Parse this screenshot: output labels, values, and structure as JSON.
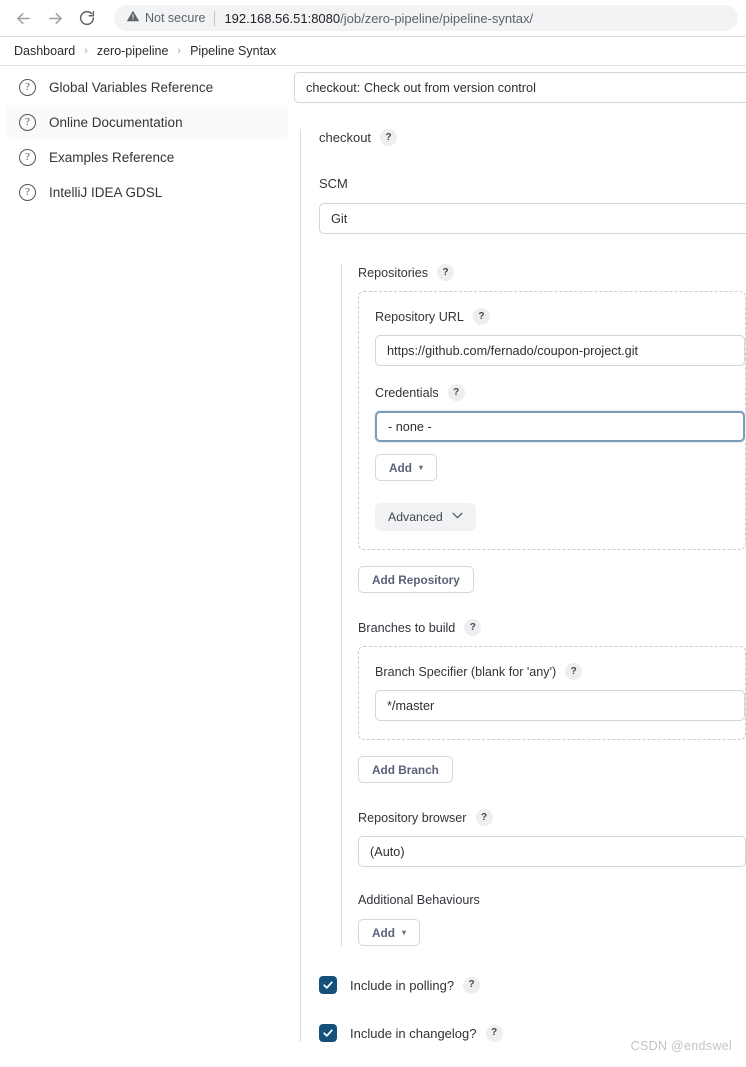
{
  "browser": {
    "back_icon": "arrow-left-icon",
    "forward_icon": "arrow-right-icon",
    "reload_icon": "reload-icon",
    "security_icon": "warning-triangle-icon",
    "security_label": "Not secure",
    "url_host": "192.168.56.51:8080",
    "url_path": "/job/zero-pipeline/pipeline-syntax/"
  },
  "breadcrumb": {
    "separator": "›",
    "items": [
      {
        "label": "Dashboard"
      },
      {
        "label": "zero-pipeline"
      },
      {
        "label": "Pipeline Syntax"
      }
    ]
  },
  "sidebar": {
    "items": [
      {
        "label": "Global Variables Reference",
        "icon": "question-circle-icon",
        "hovered": false
      },
      {
        "label": "Online Documentation",
        "icon": "question-circle-icon",
        "hovered": true
      },
      {
        "label": "Examples Reference",
        "icon": "question-circle-icon",
        "hovered": false
      },
      {
        "label": "IntelliJ IDEA GDSL",
        "icon": "question-circle-icon",
        "hovered": false
      }
    ]
  },
  "form": {
    "step_select_value": "checkout: Check out from version control",
    "step_title": "checkout",
    "step_title_help": "?",
    "scm_label": "SCM",
    "scm_value": "Git",
    "repositories_label": "Repositories",
    "repositories_help": "?",
    "repository_url_label": "Repository URL",
    "repository_url_help": "?",
    "repository_url_value": "https://github.com/fernado/coupon-project.git",
    "credentials_label": "Credentials",
    "credentials_help": "?",
    "credentials_value": "- none -",
    "credentials_add_label": "Add",
    "credentials_add_caret": "▾",
    "advanced_label": "Advanced",
    "advanced_chevron": "⌄",
    "add_repository_label": "Add Repository",
    "branches_label": "Branches to build",
    "branches_help": "?",
    "branch_specifier_label": "Branch Specifier (blank for 'any')",
    "branch_specifier_help": "?",
    "branch_specifier_value": "*/master",
    "add_branch_label": "Add Branch",
    "repository_browser_label": "Repository browser",
    "repository_browser_help": "?",
    "repository_browser_value": "(Auto)",
    "additional_behaviours_label": "Additional Behaviours",
    "additional_behaviours_add_label": "Add",
    "additional_behaviours_add_caret": "▾",
    "include_polling_label": "Include in polling?",
    "include_polling_help": "?",
    "include_polling_checked": true,
    "include_changelog_label": "Include in changelog?",
    "include_changelog_help": "?",
    "include_changelog_checked": true
  },
  "watermark": "CSDN @endswel",
  "colors": {
    "checkbox_fill": "#14507b",
    "focus_border": "#7a9cb6",
    "button_text": "#5b6178",
    "not_secure_text": "#5f6368"
  }
}
